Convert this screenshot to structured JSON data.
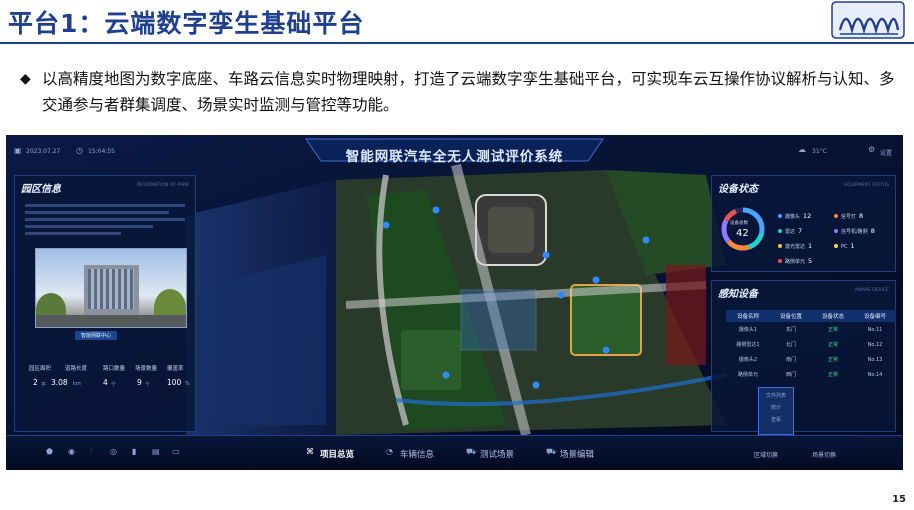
{
  "slide": {
    "title": "平台1：云端数字孪生基础平台",
    "bullet_mark": "◆",
    "bullet_text": "以高精度地图为数字底座、车路云信息实时物理映射，打造了云端数字孪生基础平台，可实现车云互操作协议解析与认知、多交通参与者群集调度、场景实时监测与管控等功能。",
    "page_number": "15",
    "accent_color": "#1f3f8f"
  },
  "screen": {
    "system_title": "智能网联汽车全无人测试评价系统",
    "date": "2023.07.27",
    "time": "15:04:55",
    "weather": "31°C",
    "settings_label": "设置",
    "left_panel": {
      "title": "园区信息",
      "subtitle": "INFORMATION OF PARK",
      "photo_caption": "智能网联中心",
      "stats": [
        {
          "label": "园区面积",
          "value": "2",
          "unit": "平"
        },
        {
          "label": "道路长度",
          "value": "3.08",
          "unit": "km"
        },
        {
          "label": "路口数量",
          "value": "4",
          "unit": "个"
        },
        {
          "label": "场景数量",
          "value": "9",
          "unit": "个"
        },
        {
          "label": "覆盖率",
          "value": "100",
          "unit": "%"
        }
      ]
    },
    "device_panel": {
      "title": "设备状态",
      "subtitle": "EQUIPMENT STATUS",
      "total_label": "设备总数",
      "total": "42",
      "items": [
        {
          "name": "摄像头",
          "count": "12",
          "color": "#4aa3ff"
        },
        {
          "name": "雷达",
          "count": "7",
          "color": "#23d1c6"
        },
        {
          "name": "激光雷达",
          "count": "1",
          "color": "#f0c23a"
        },
        {
          "name": "路侧单元",
          "count": "5",
          "color": "#e05656"
        },
        {
          "name": "信号灯",
          "count": "8",
          "color": "#ff8a3d"
        },
        {
          "name": "信号机/路侧",
          "count": "8",
          "color": "#8e7bff"
        },
        {
          "name": "PC",
          "count": "1",
          "color": "#ffd84a"
        }
      ]
    },
    "sensing_panel": {
      "title": "感知设备",
      "subtitle": "AWARE DEVICE",
      "columns": [
        "设备名称",
        "设备位置",
        "设备状态",
        "设备编号"
      ],
      "rows": [
        [
          "摄像头1",
          "东门",
          "正常",
          "No.11"
        ],
        [
          "路侧雷达1",
          "北门",
          "正常",
          "No.12"
        ],
        [
          "摄像头2",
          "南门",
          "正常",
          "No.13"
        ],
        [
          "路侧单元",
          "西门",
          "正常",
          "No.14"
        ]
      ]
    },
    "bottom_nav": [
      {
        "label": "项目总览",
        "active": true
      },
      {
        "label": "车辆信息",
        "active": false
      },
      {
        "label": "测试场景",
        "active": false
      },
      {
        "label": "场景编辑",
        "active": false
      }
    ],
    "bottom_right": [
      "区域切换",
      "场景切换"
    ],
    "popup_items": [
      "文件列表",
      "统计",
      "查看"
    ]
  }
}
